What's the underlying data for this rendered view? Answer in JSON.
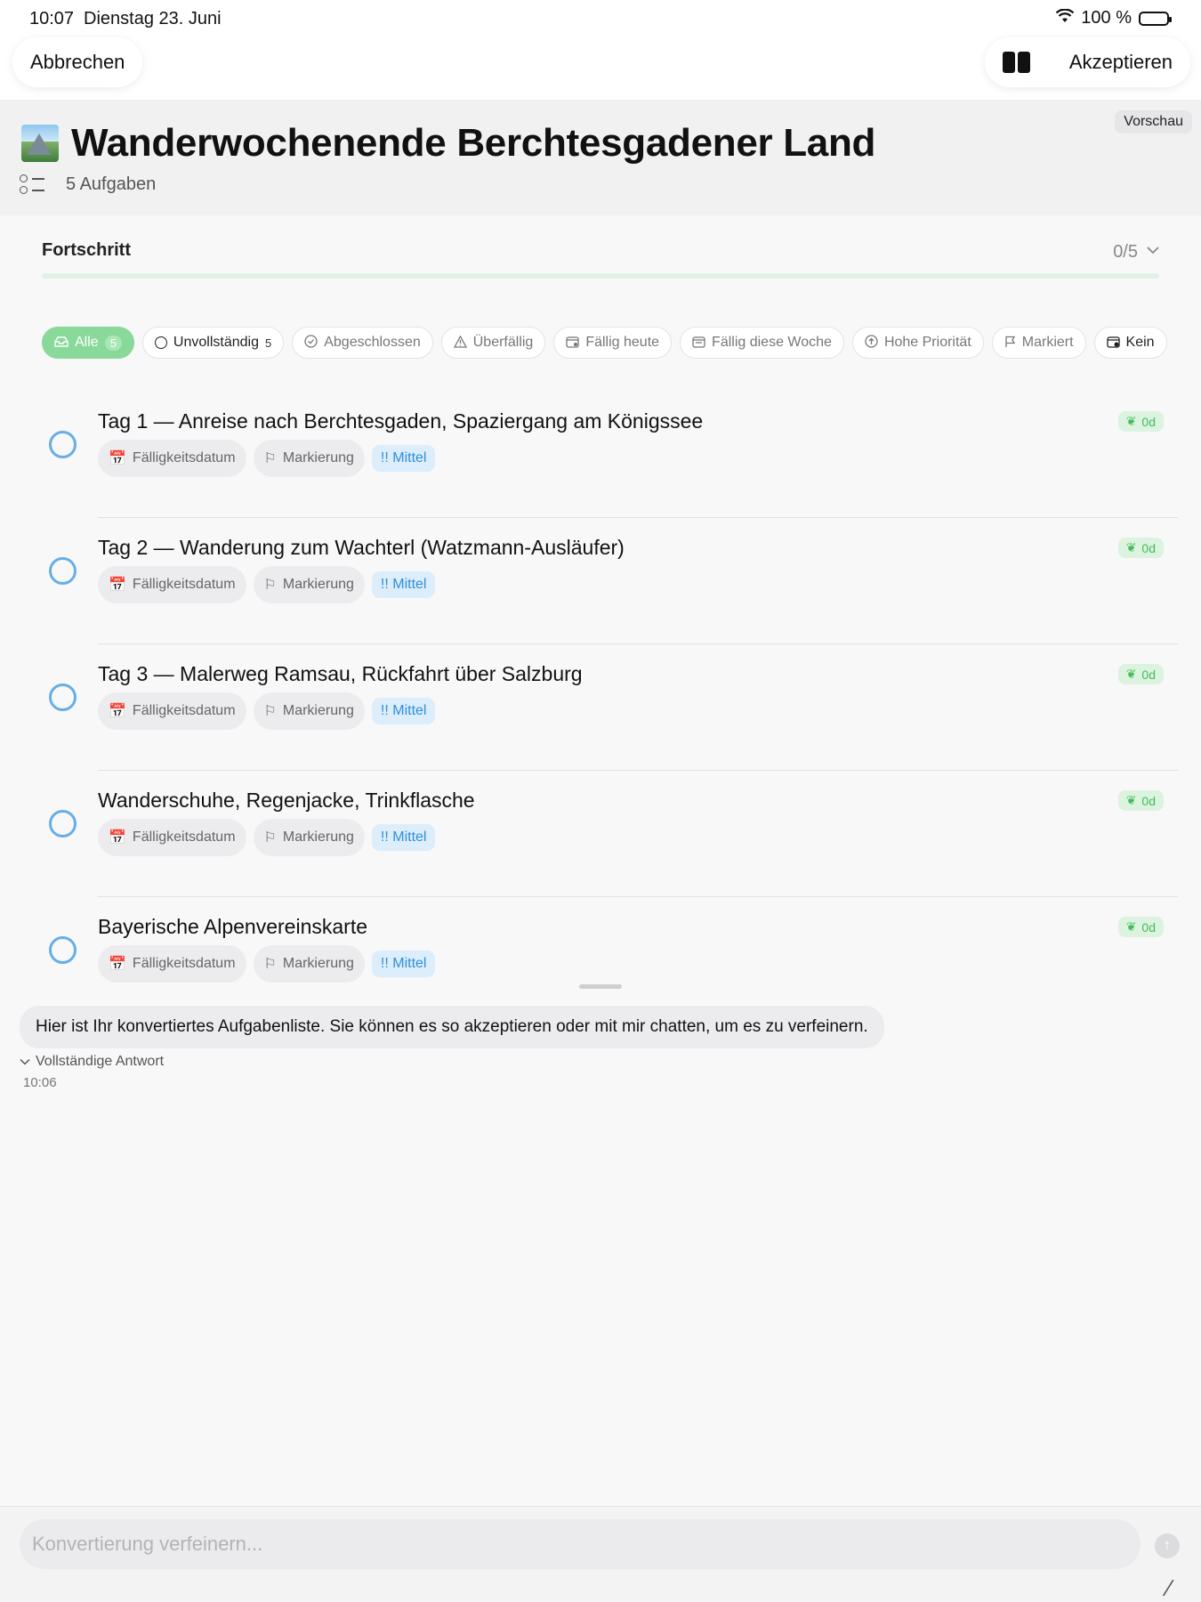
{
  "status_bar": {
    "time": "10:07",
    "date": "Dienstag 23. Juni",
    "battery": "100 %"
  },
  "nav": {
    "cancel_label": "Abbrechen",
    "accept_label": "Akzeptieren"
  },
  "header": {
    "preview_badge": "Vorschau",
    "title": "Wanderwochenende Berchtesgadener Land",
    "task_count": "5 Aufgaben"
  },
  "progress": {
    "label": "Fortschritt",
    "value": "0/5",
    "fraction": 0
  },
  "filters": [
    {
      "label": "Alle",
      "count": "5",
      "icon": "tray-icon",
      "active": true
    },
    {
      "label": "Unvollständig",
      "count": "5",
      "icon": "circle-icon"
    },
    {
      "label": "Abgeschlossen",
      "icon": "check-circle-icon"
    },
    {
      "label": "Überfällig",
      "icon": "warning-icon"
    },
    {
      "label": "Fällig heute",
      "icon": "calendar-today-icon"
    },
    {
      "label": "Fällig diese Woche",
      "icon": "calendar-icon"
    },
    {
      "label": "Hohe Priorität",
      "icon": "arrow-up-circle-icon"
    },
    {
      "label": "Markiert",
      "icon": "flag-icon"
    },
    {
      "label": "Kein",
      "icon": "calendar-none-icon"
    }
  ],
  "tasks": [
    {
      "title": "Tag 1 — Anreise nach Berchtesgaden, Spaziergang am Königssee",
      "due_label": "Fälligkeitsdatum",
      "flag_label": "Markierung",
      "priority": "!! Mittel",
      "age": "0d"
    },
    {
      "title": "Tag 2 — Wanderung zum Wachterl (Watzmann-Ausläufer)",
      "due_label": "Fälligkeitsdatum",
      "flag_label": "Markierung",
      "priority": "!! Mittel",
      "age": "0d"
    },
    {
      "title": "Tag 3 — Malerweg Ramsau, Rückfahrt über Salzburg",
      "due_label": "Fälligkeitsdatum",
      "flag_label": "Markierung",
      "priority": "!! Mittel",
      "age": "0d"
    },
    {
      "title": "Wanderschuhe, Regenjacke, Trinkflasche",
      "due_label": "Fälligkeitsdatum",
      "flag_label": "Markierung",
      "priority": "!! Mittel",
      "age": "0d"
    },
    {
      "title": "Bayerische Alpenvereinskarte",
      "due_label": "Fälligkeitsdatum",
      "flag_label": "Markierung",
      "priority": "!! Mittel",
      "age": "0d"
    }
  ],
  "chat": {
    "message": "Hier ist Ihr konvertiertes Aufgabenliste. Sie können es so akzeptieren oder mit mir chatten, um es zu verfeinern.",
    "full_answer_label": "Vollständige Antwort",
    "time": "10:06"
  },
  "input": {
    "placeholder": "Konvertierung verfeinern..."
  },
  "colors": {
    "accent_green": "#89d99a",
    "check_blue": "#66aee8",
    "priority_blue": "#2f8fd8"
  }
}
